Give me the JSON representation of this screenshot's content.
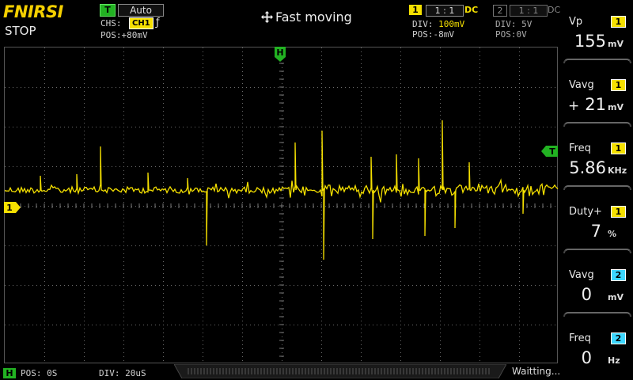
{
  "header": {
    "brand": "FNIRSI",
    "run_state": "STOP",
    "trigger": {
      "badge": "T",
      "mode": "Auto",
      "chs_label": "CHS:",
      "chs_value": "CH1",
      "edge_icon": "rising-edge-icon",
      "edge_glyph": "ƒ",
      "pos_label": "POS:",
      "pos_value": "+80mV"
    },
    "center_message": "Fast moving",
    "move_icon": "move-arrows-icon",
    "ch1": {
      "badge": "1",
      "ratio": "1 : 1",
      "coupling": "DC",
      "div_label": "DIV:",
      "div_value": "100mV",
      "pos_label": "POS:",
      "pos_value": "-8mV"
    },
    "ch2": {
      "badge": "2",
      "ratio": "1 : 1",
      "coupling": "DC",
      "div_label": "DIV:",
      "div_value": "5V",
      "pos_label": "POS:",
      "pos_value": "0V"
    }
  },
  "screen": {
    "h_marker": "H",
    "ch1_marker": "1",
    "trigger_marker": "T"
  },
  "measurements": [
    {
      "label": "Vp",
      "channel": "1",
      "value": "155",
      "unit": "mV",
      "sign": ""
    },
    {
      "label": "Vavg",
      "channel": "1",
      "value": "21",
      "unit": "mV",
      "sign": "+"
    },
    {
      "label": "Freq",
      "channel": "1",
      "value": "5.86",
      "unit": "KHz",
      "sign": ""
    },
    {
      "label": "Duty+",
      "channel": "1",
      "value": "7",
      "unit": "%",
      "sign": ""
    },
    {
      "label": "Vavg",
      "channel": "2",
      "value": "0",
      "unit": "mV",
      "sign": ""
    },
    {
      "label": "Freq",
      "channel": "2",
      "value": "0",
      "unit": "Hz",
      "sign": ""
    }
  ],
  "footer": {
    "h_badge": "H",
    "pos_label": "POS:",
    "pos_value": "0S",
    "div_label": "DIV:",
    "div_value": "20uS",
    "status": "Waitting..."
  },
  "colors": {
    "ch1": "#f5e000",
    "ch2": "#3cd7ff",
    "trigger": "#22b222"
  }
}
